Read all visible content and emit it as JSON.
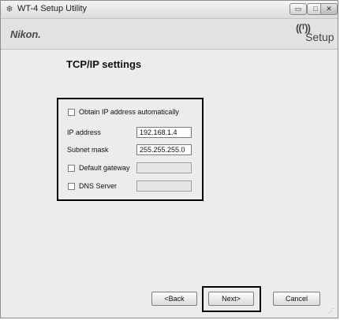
{
  "window": {
    "title": "WT-4 Setup Utility",
    "app_icon": "❄",
    "controls": {
      "minimize": "▭",
      "maximize": "□",
      "close": "✕"
    }
  },
  "header": {
    "brand": "Nikon.",
    "logo_signal": "((ᵀ))",
    "logo_text": "Setup"
  },
  "page": {
    "title": "TCP/IP settings"
  },
  "settings": {
    "obtain_auto": {
      "label": "Obtain IP address automatically",
      "checked": false
    },
    "ip_address": {
      "label": "IP address",
      "value": "192.168.1.4"
    },
    "subnet_mask": {
      "label": "Subnet mask",
      "value": "255.255.255.0"
    },
    "default_gateway": {
      "label": "Default gateway",
      "checked": false,
      "value": ""
    },
    "dns_server": {
      "label": "DNS Server",
      "checked": false,
      "value": ""
    }
  },
  "buttons": {
    "back": "<Back",
    "next": "Next>",
    "cancel": "Cancel"
  },
  "colors": {
    "window_bg": "#ececec",
    "highlight_border": "#000000"
  }
}
